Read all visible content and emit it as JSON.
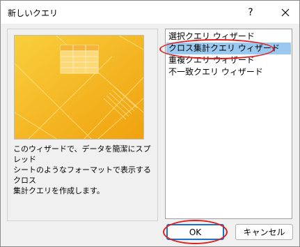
{
  "dialog": {
    "title": "新しいクエリ"
  },
  "titlebar": {
    "help_label": "?",
    "close_icon": "close-icon"
  },
  "description": "このウィザードで、データを簡潔にスプレッド\nシートのようなフォーマットで表示するクロス\n集計クエリを作成します。",
  "wizard_list": {
    "items": [
      {
        "label": "選択クエリ ウィザード",
        "selected": false
      },
      {
        "label": "クロス集計クエリ ウィザード",
        "selected": true
      },
      {
        "label": "重複クエリ ウィザード",
        "selected": false
      },
      {
        "label": "不一致クエリ ウィザード",
        "selected": false
      }
    ]
  },
  "buttons": {
    "ok": "OK",
    "cancel": "キャンセル"
  },
  "colors": {
    "selection": "#99c9ef",
    "highlight_ring": "#e02020",
    "art_orange": "#f4b71a",
    "default_button_border": "#1a73c7"
  }
}
